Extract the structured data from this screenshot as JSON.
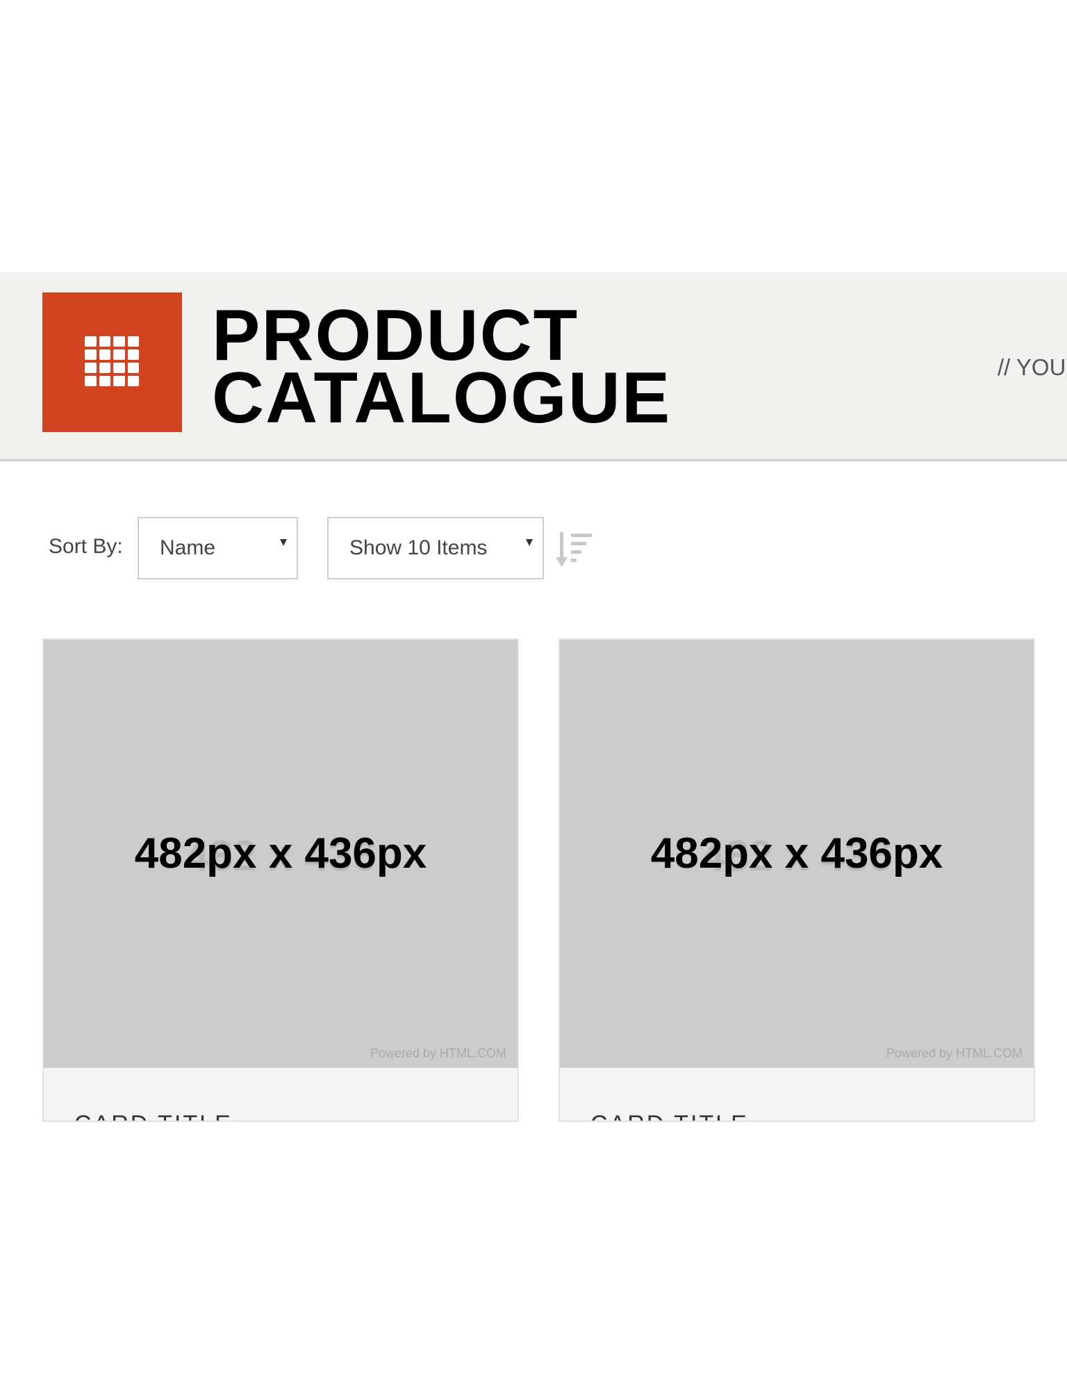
{
  "header": {
    "logo_icon": "grid-icon",
    "brand_color": "#d0441f",
    "title_line1": "PRODUCT",
    "title_line2": "CATALOGUE",
    "tagline": "// YOU"
  },
  "toolbar": {
    "sort_label": "Sort By:",
    "sort_value": "Name",
    "show_value": "Show 10 Items",
    "order_icon": "sort-descending-icon"
  },
  "cards": [
    {
      "image_ghost_text": "482 x 436",
      "image_text": "482px x 436px",
      "powered_by": "Powered by HTML.COM",
      "title": "CARD TITLE"
    },
    {
      "image_ghost_text": "482 x 436",
      "image_text": "482px x 436px",
      "powered_by": "Powered by HTML.COM",
      "title": "CARD TITLE"
    }
  ]
}
